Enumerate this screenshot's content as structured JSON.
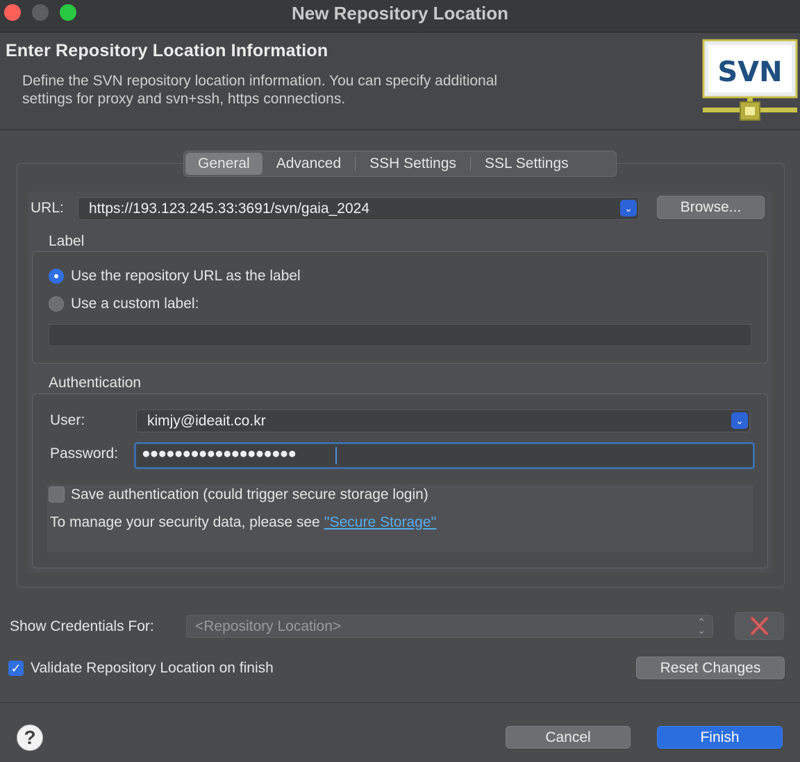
{
  "window": {
    "title": "New Repository Location"
  },
  "header": {
    "title": "Enter Repository Location Information",
    "description": "Define the SVN repository location information. You can specify additional settings for proxy and svn+ssh, https connections.",
    "logo_text": "SVN"
  },
  "tabs": [
    {
      "label": "General",
      "active": true
    },
    {
      "label": "Advanced",
      "active": false
    },
    {
      "label": "SSH Settings",
      "active": false
    },
    {
      "label": "SSL Settings",
      "active": false
    }
  ],
  "url": {
    "label": "URL:",
    "value": "https://193.123.245.33:3691/svn/gaia_2024",
    "browse_label": "Browse..."
  },
  "label_group": {
    "title": "Label",
    "options": [
      {
        "label": "Use the repository URL as the label",
        "selected": true
      },
      {
        "label": "Use a custom label:",
        "selected": false
      }
    ],
    "custom_value": ""
  },
  "authentication": {
    "title": "Authentication",
    "user_label": "User:",
    "user_value": "kimjy@ideait.co.kr",
    "password_label": "Password:",
    "password_value": "●●●●●●●●●●●●●●●●●●●",
    "save_label": "Save authentication (could trigger secure storage login)",
    "save_checked": false,
    "manage_text": "To manage your security data, please see ",
    "manage_link": "''Secure Storage''"
  },
  "credentials": {
    "label": "Show Credentials For:",
    "selected": "<Repository Location>"
  },
  "validate": {
    "label": "Validate Repository Location on finish",
    "checked": true
  },
  "buttons": {
    "reset": "Reset Changes",
    "cancel": "Cancel",
    "finish": "Finish",
    "help": "?"
  },
  "colors": {
    "accent": "#2b6ee0",
    "close": "#fe5f57",
    "maximize": "#28c840",
    "link": "#57aef0"
  }
}
